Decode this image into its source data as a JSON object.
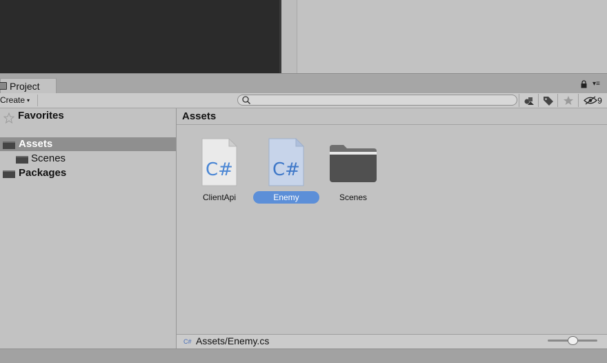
{
  "window": {
    "tab_label": "Project",
    "tab_icon": "project-tab-icon",
    "accent_color": "#5c8fd8"
  },
  "toolbar": {
    "create_label": "Create",
    "create_arrow": "▾",
    "search_placeholder": "",
    "hidden_packages_count": "9"
  },
  "tree": {
    "favorites_label": "Favorites",
    "items": [
      {
        "label": "Assets",
        "selected": true
      },
      {
        "label": "Scenes",
        "selected": false
      },
      {
        "label": "Packages",
        "selected": false
      }
    ]
  },
  "content": {
    "header_title": "Assets",
    "assets": [
      {
        "name": "ClientApi",
        "type": "csharp-script",
        "glyph": "C#",
        "selected": false
      },
      {
        "name": "Enemy",
        "type": "csharp-script",
        "glyph": "C#",
        "selected": true
      },
      {
        "name": "Scenes",
        "type": "folder",
        "glyph": "",
        "selected": false
      }
    ]
  },
  "status": {
    "cs_icon_text": "C#",
    "path": "Assets/Enemy.cs",
    "zoom_level": 0.5
  }
}
